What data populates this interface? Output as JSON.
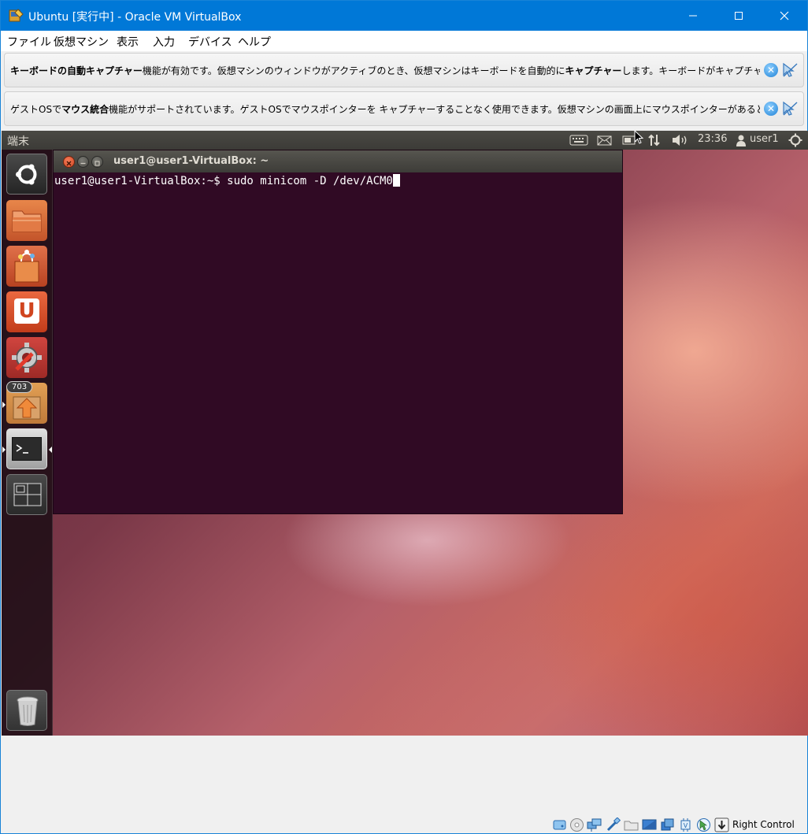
{
  "window": {
    "title": "Ubuntu [実行中] - Oracle VM VirtualBox"
  },
  "menubar": {
    "items": [
      "ファイル",
      "仮想マシン",
      "表示",
      "入力",
      "デバイス",
      "ヘルプ"
    ]
  },
  "notices": [
    {
      "bold1": "キーボードの自動キャプチャー",
      "text1": "機能が有効です。仮想マシンのウィンドウがアクティブのとき、仮想マシンはキーボードを自動的に",
      "bold2": "キャプチャー",
      "text2": "します。キーボードがキャプチャーされると、すべ"
    },
    {
      "text0": "ゲストOSで",
      "bold1": "マウス統合",
      "text1": "機能がサポートされています。ゲストOSでマウスポインターを キャプチャーすることなく使用できます。仮想マシンの画面上にマウスポインターがあるとき、すべてのマウスの"
    }
  ],
  "ubuntu_panel": {
    "app_title": "端末",
    "time": "23:36",
    "user": "user1"
  },
  "launcher": {
    "badge_count": "703"
  },
  "terminal": {
    "title": "user1@user1-VirtualBox: ~",
    "line": "user1@user1-VirtualBox:~$ sudo minicom -D /dev/ACM0"
  },
  "statusbar": {
    "host_key": "Right Control"
  }
}
